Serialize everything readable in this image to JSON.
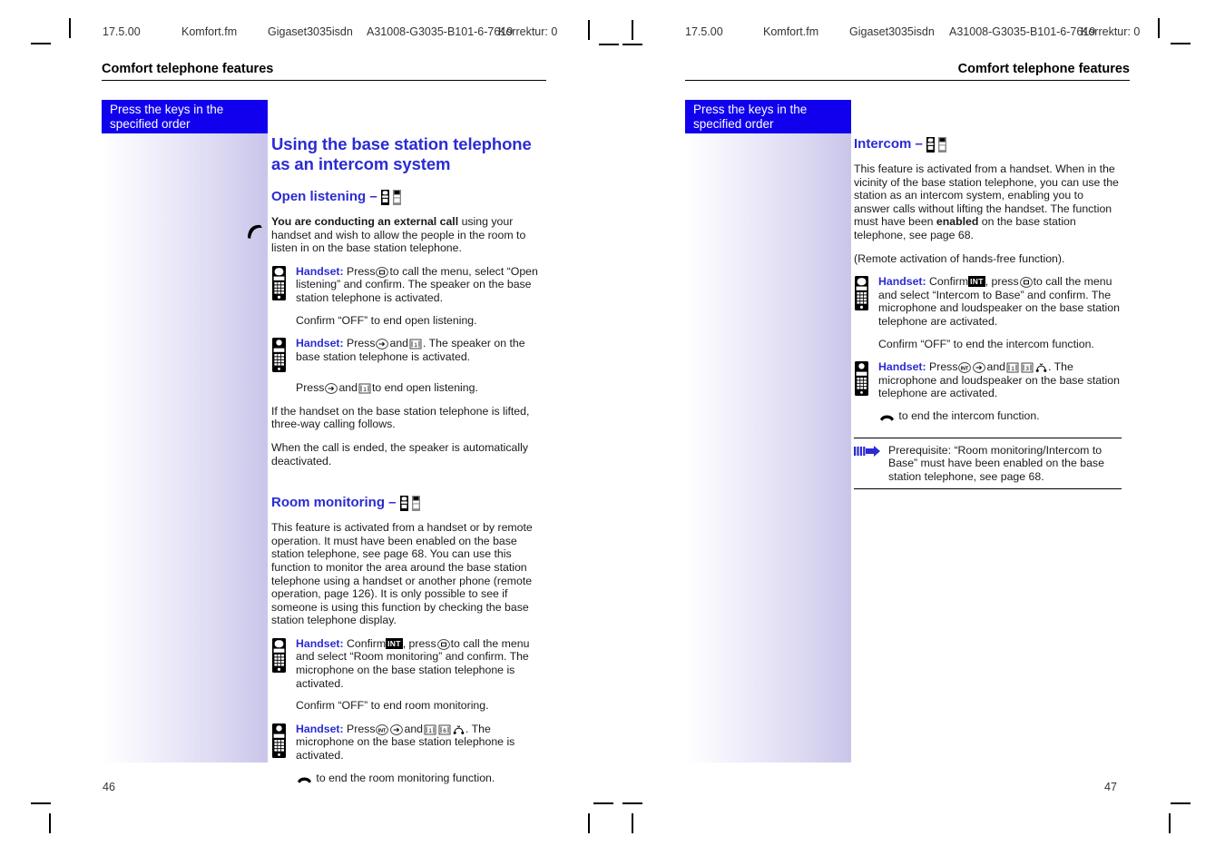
{
  "printer_header": {
    "date": "17.5.00",
    "file": "Komfort.fm",
    "product": "Gigaset3035isdn",
    "docnum": "A31008-G3035-B101-6-7619",
    "correction": "Korrektur: 0"
  },
  "running_head": "Comfort telephone features",
  "sidebar": {
    "banner_line1": "Press the keys in the",
    "banner_line2": "specified order",
    "banner_color": "#1100ee"
  },
  "left_page": {
    "page_number": "46",
    "title": "Using the base station telephone as an intercom system",
    "section1": {
      "heading": "Open listening –",
      "intro_bold": "You are conducting an external call",
      "intro_rest": " using your handset and wish to allow the people in the room to listen in on the base station telephone.",
      "step1_label": "Handset:",
      "step1_a": "Press",
      "step1_b": "to call the menu, select “Open listening” and confirm. The speaker on the base station telephone is activated.",
      "step1_note": "Confirm “OFF” to end open listening.",
      "step2_label": "Handset:",
      "step2_a": "Press",
      "step2_b": "and",
      "step2_c": ". The speaker on the base station telephone is activated.",
      "step2_note_a": "Press",
      "step2_note_b": "and",
      "step2_note_c": "to end open listening.",
      "para2": "If the handset on the base station telephone is lifted, three-way calling follows.",
      "para3": "When the call is ended, the speaker is automatically deactivated."
    },
    "section2": {
      "heading": "Room monitoring –",
      "intro": "This feature is activated from a handset or by remote operation. It must have been enabled on the base station telephone, see page 68. You can use this function to monitor the area around the base station telephone using a handset or another phone (remote operation, page 126). It is only possible to see if someone is using this function by checking the base station telephone display.",
      "step1_label": "Handset:",
      "step1_a": "Confirm",
      "step1_badge": "INT",
      "step1_b": ", press",
      "step1_c": "to call the menu and select “Room monitoring” and confirm. The microphone on the base station telephone is activated.",
      "step1_note": "Confirm “OFF” to end room monitoring.",
      "step2_label": "Handset:",
      "step2_a": "Press",
      "step2_b": "and",
      "step2_c": ". The microphone on the base station telephone is activated.",
      "step2_end": "to end the room monitoring function."
    }
  },
  "right_page": {
    "page_number": "47",
    "section1": {
      "heading": "Intercom –",
      "intro_a": "This feature is activated from a handset. When in the vicinity of the base station telephone, you can use the station as an intercom system, enabling you to answer calls without lifting the handset. The function must have been ",
      "intro_bold": "enabled",
      "intro_b": " on the base station telephone, see page 68.",
      "para2": "(Remote activation of hands-free function).",
      "step1_label": "Handset:",
      "step1_a": "Confirm",
      "step1_badge": "INT",
      "step1_b": ", press",
      "step1_c": "to call the menu and select “Intercom to Base” and confirm. The microphone and loudspeaker on the base station telephone are activated.",
      "step1_note": "Confirm “OFF” to end the intercom function.",
      "step2_label": "Handset:",
      "step2_a": "Press",
      "step2_b": "and",
      "step2_c": ". The microphone and loudspeaker on the base station telephone are activated.",
      "step2_end": "to end the intercom function."
    },
    "note": {
      "text": "Prerequisite: “Room monitoring/Intercom to Base” must have been enabled on the base station telephone, see page 68."
    }
  },
  "icons": {
    "handset": "handset-icon",
    "base_station": "base-station-icon",
    "menu_key": "menu-key-icon",
    "accept_call_key": "accept-call-key-icon",
    "int_key": "int-key-icon",
    "digit_key": "digit-key-icon",
    "handsfree_key": "handsfree-key-icon",
    "hangup": "hangup-icon",
    "note_arrow": "note-arrow-icon"
  }
}
